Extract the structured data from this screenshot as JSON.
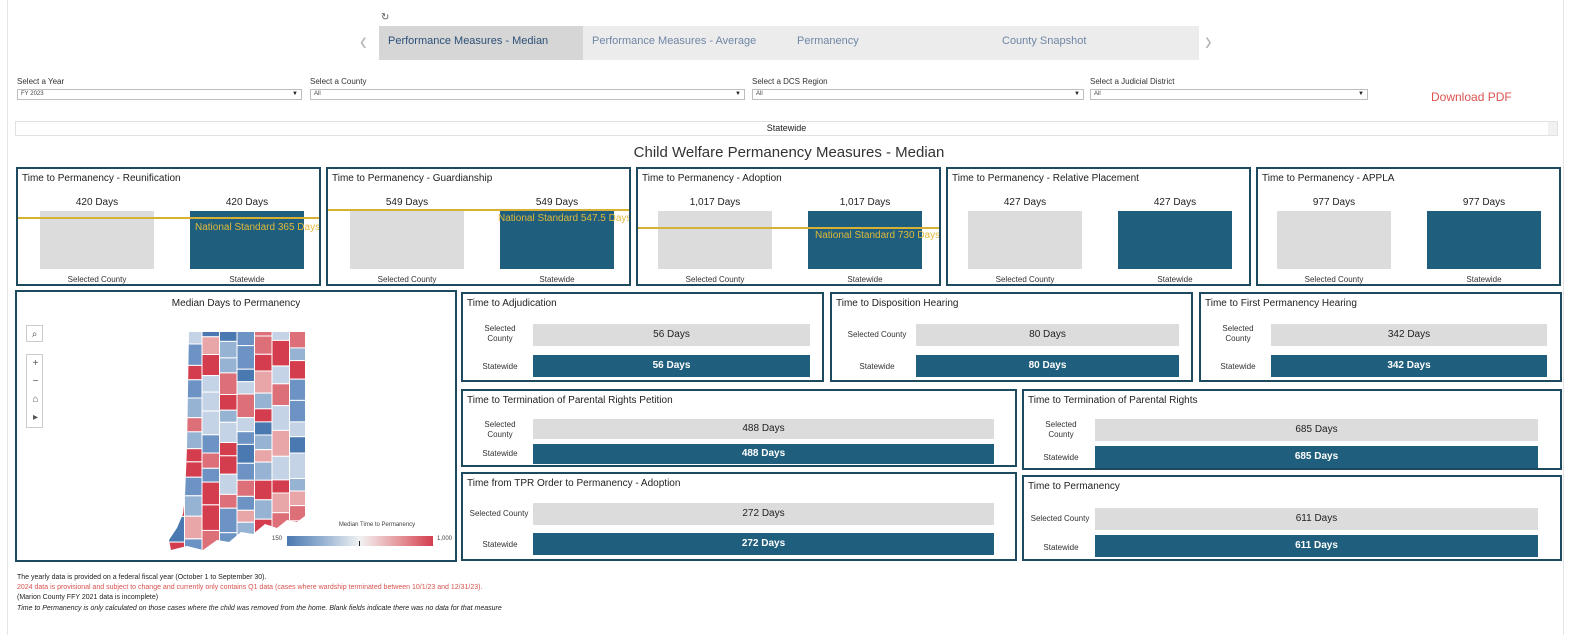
{
  "tabs": {
    "refresh_icon": "↻",
    "items": [
      {
        "label": "Performance Measures - Median"
      },
      {
        "label": "Performance Measures - Average"
      },
      {
        "label": "Permanency"
      },
      {
        "label": "County Snapshot"
      }
    ]
  },
  "filters": {
    "year": {
      "label": "Select a Year",
      "value": "FY 2023"
    },
    "county": {
      "label": "Select a County",
      "value": "All"
    },
    "region": {
      "label": "Select a DCS Region",
      "value": "All"
    },
    "district": {
      "label": "Select a Judicial District",
      "value": "All"
    },
    "download_label": "Download PDF"
  },
  "statewide_label": "Statewide",
  "title": "Child Welfare Permanency Measures - Median",
  "colors": {
    "primary": "#1f5f7d",
    "gray_bar": "#dcdcdc",
    "standard_line": "#d6b133",
    "border": "#1e4a5f",
    "download": "#d9534f"
  },
  "top_cards": [
    {
      "title": "Time to Permanency - Reunification",
      "county_value": "420 Days",
      "state_value": "420 Days",
      "county_caption": "Selected County",
      "state_caption": "Statewide",
      "standard": "National Standard 365 Days"
    },
    {
      "title": "Time to Permanency - Guardianship",
      "county_value": "549 Days",
      "state_value": "549 Days",
      "county_caption": "Selected County",
      "state_caption": "Statewide",
      "standard": "National Standard 547.5 Days"
    },
    {
      "title": "Time to Permanency - Adoption",
      "county_value": "1,017 Days",
      "state_value": "1,017 Days",
      "county_caption": "Selected County",
      "state_caption": "Statewide",
      "standard": "National Standard 730 Days"
    },
    {
      "title": "Time to Permanency - Relative Placement",
      "county_value": "427 Days",
      "state_value": "427 Days",
      "county_caption": "Selected County",
      "state_caption": "Statewide"
    },
    {
      "title": "Time to Permanency - APPLA",
      "county_value": "977 Days",
      "state_value": "977 Days",
      "county_caption": "Selected County",
      "state_caption": "Statewide"
    }
  ],
  "map": {
    "title": "Median Days to Permanency",
    "legend_title": "Median Time to Permanency",
    "legend_min": "150",
    "legend_max": "1,000",
    "controls": {
      "search": "⌕",
      "zoom_in": "+",
      "zoom_out": "−",
      "home": "⌂",
      "play": "▸"
    }
  },
  "measure_cards": [
    {
      "title": "Time to Adjudication",
      "county_label": "Selected County",
      "county_value": "56 Days",
      "state_label": "Statewide",
      "state_value": "56 Days"
    },
    {
      "title": "Time to Disposition Hearing",
      "county_label": "Selected County",
      "county_value": "80 Days",
      "state_label": "Statewide",
      "state_value": "80 Days"
    },
    {
      "title": "Time to First Permanency Hearing",
      "county_label": "Selected County",
      "county_value": "342 Days",
      "state_label": "Statewide",
      "state_value": "342 Days"
    },
    {
      "title": "Time to Termination of Parental Rights Petition",
      "county_label": "Selected County",
      "county_value": "488 Days",
      "state_label": "Statewide",
      "state_value": "488 Days"
    },
    {
      "title": "Time to Termination of Parental Rights",
      "county_label": "Selected County",
      "county_value": "685 Days",
      "state_label": "Statewide",
      "state_value": "685 Days"
    },
    {
      "title": "Time from TPR Order to Permanency - Adoption",
      "county_label": "Selected County",
      "county_value": "272 Days",
      "state_label": "Statewide",
      "state_value": "272 Days"
    },
    {
      "title": "Time to Permanency",
      "county_label": "Selected County",
      "county_value": "611 Days",
      "state_label": "Statewide",
      "state_value": "611 Days"
    }
  ],
  "footnotes": [
    "The yearly data is provided on a federal fiscal year (October 1 to September 30).",
    "2024 data is provisional and subject to change and currently only contains Q1 data (cases where wardship terminated between 10/1/23 and 12/31/23).",
    "(Marion County FFY 2021 data is incomplete)",
    "Time to Permanency is only calculated on those cases where the child was removed from the home. Blank fields indicate there was no data for that measure"
  ]
}
